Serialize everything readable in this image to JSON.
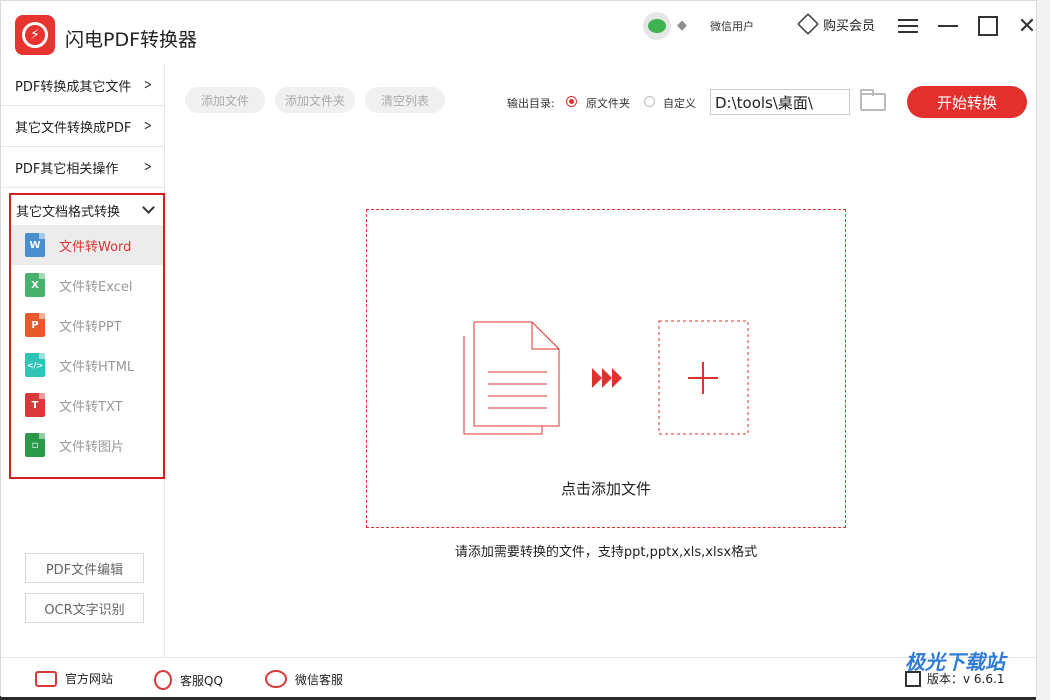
{
  "app": {
    "title": "闪电PDF转换器",
    "user": "微信用户",
    "buy_vip": "购买会员"
  },
  "sidebar": {
    "items": [
      {
        "label": "PDF转换成其它文件"
      },
      {
        "label": "其它文件转换成PDF"
      },
      {
        "label": "PDF其它相关操作"
      }
    ],
    "group": {
      "label": "其它文档格式转换",
      "items": [
        {
          "label": "文件转Word",
          "icon": "W",
          "active": true
        },
        {
          "label": "文件转Excel",
          "icon": "X"
        },
        {
          "label": "文件转PPT",
          "icon": "P"
        },
        {
          "label": "文件转HTML",
          "icon": "</>"
        },
        {
          "label": "文件转TXT",
          "icon": "T"
        },
        {
          "label": "文件转图片",
          "icon": "img"
        }
      ]
    },
    "pdf_edit": "PDF文件编辑",
    "ocr": "OCR文字识别"
  },
  "toolbar": {
    "add_file": "添加文件",
    "add_folder": "添加文件夹",
    "clear_list": "清空列表",
    "output_label": "输出目录:",
    "option_original": "原文件夹",
    "option_custom": "自定义",
    "selected_option": "原文件夹",
    "path": "D:\\tools\\桌面\\",
    "start": "开始转换"
  },
  "dropzone": {
    "text": "点击添加文件"
  },
  "hint": "请添加需要转换的文件，支持ppt,pptx,xls,xlsx格式",
  "footer": {
    "website": "官方网站",
    "qq": "客服QQ",
    "wechat": "微信客服",
    "version": "版本：v 6.6.1"
  },
  "watermark": "极光下载站",
  "colors": {
    "accent": "#e3302c",
    "highlight_box": "#d81e1e"
  }
}
